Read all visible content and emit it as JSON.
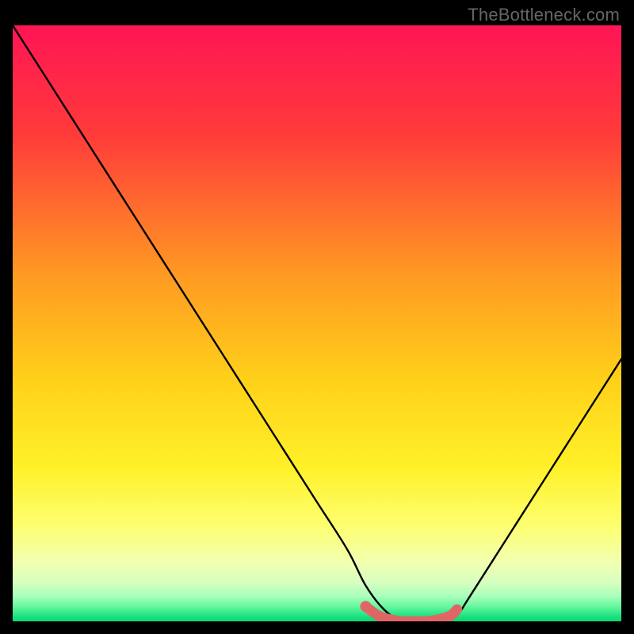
{
  "watermark": "TheBottleneck.com",
  "chart_data": {
    "type": "line",
    "title": "",
    "xlabel": "",
    "ylabel": "",
    "xlim": [
      0,
      100
    ],
    "ylim": [
      0,
      100
    ],
    "grid": false,
    "legend": false,
    "series": [
      {
        "name": "bottleneck-curve",
        "x": [
          0,
          5,
          10,
          15,
          20,
          25,
          30,
          35,
          40,
          45,
          50,
          55,
          58,
          61,
          64,
          67,
          71,
          73,
          75,
          80,
          85,
          90,
          95,
          100
        ],
        "values": [
          100,
          92,
          84,
          76,
          68,
          60,
          52,
          44,
          36,
          28,
          20,
          12,
          6,
          2,
          0,
          0,
          0,
          1,
          4,
          12,
          20,
          28,
          36,
          44
        ],
        "color": "#000000",
        "stroke_width": 2.4
      },
      {
        "name": "optimal-band",
        "x": [
          58,
          60,
          62,
          64,
          66,
          68,
          70,
          72,
          73
        ],
        "values": [
          2.5,
          1.0,
          0.3,
          0.0,
          0.0,
          0.0,
          0.3,
          1.0,
          2.0
        ],
        "color": "#e06666",
        "stroke_width": 13
      }
    ],
    "markers": [
      {
        "name": "optimal-start-dot",
        "x": 58,
        "y": 2.5,
        "r": 7,
        "color": "#e06666"
      }
    ],
    "background_gradient": {
      "stops": [
        {
          "offset": 0.0,
          "color": "#ff1556"
        },
        {
          "offset": 0.18,
          "color": "#ff3a3a"
        },
        {
          "offset": 0.42,
          "color": "#ff9a22"
        },
        {
          "offset": 0.6,
          "color": "#ffd21a"
        },
        {
          "offset": 0.74,
          "color": "#fff028"
        },
        {
          "offset": 0.84,
          "color": "#fdff70"
        },
        {
          "offset": 0.9,
          "color": "#f2ffb0"
        },
        {
          "offset": 0.935,
          "color": "#d6ffc0"
        },
        {
          "offset": 0.958,
          "color": "#a8ffba"
        },
        {
          "offset": 0.975,
          "color": "#66f7a0"
        },
        {
          "offset": 0.992,
          "color": "#19e27f"
        },
        {
          "offset": 1.0,
          "color": "#08d873"
        }
      ]
    }
  }
}
